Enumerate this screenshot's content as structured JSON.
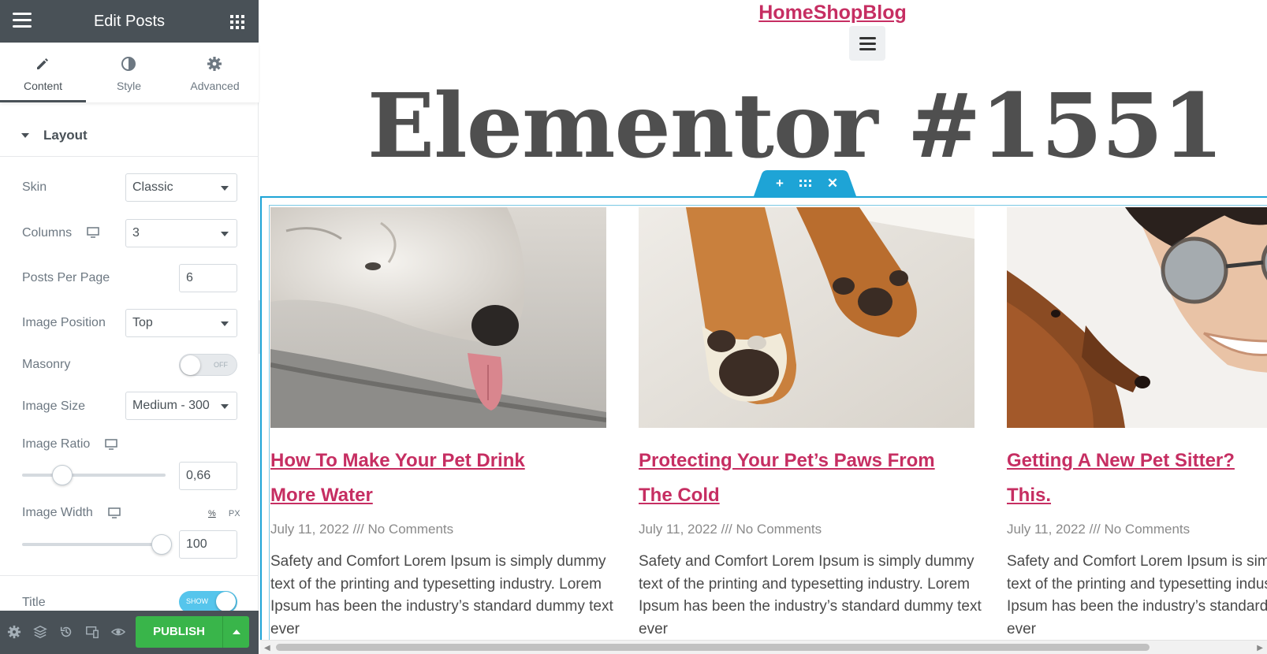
{
  "panel": {
    "title": "Edit Posts",
    "tabs": [
      {
        "label": "Content",
        "icon": "pencil-icon",
        "active": true
      },
      {
        "label": "Style",
        "icon": "half-circle-icon",
        "active": false
      },
      {
        "label": "Advanced",
        "icon": "gear-icon",
        "active": false
      }
    ],
    "section_label": "Layout",
    "controls": {
      "skin": {
        "label": "Skin",
        "value": "Classic"
      },
      "columns": {
        "label": "Columns",
        "value": "3"
      },
      "posts_per_page": {
        "label": "Posts Per Page",
        "value": "6"
      },
      "image_position": {
        "label": "Image Position",
        "value": "Top"
      },
      "masonry": {
        "label": "Masonry",
        "state": "OFF"
      },
      "image_size": {
        "label": "Image Size",
        "value": "Medium - 300"
      },
      "image_ratio": {
        "label": "Image Ratio",
        "value": "0,66"
      },
      "image_width": {
        "label": "Image Width",
        "value": "100",
        "unit_percent": "%",
        "unit_px": "PX"
      },
      "title": {
        "label": "Title",
        "state": "SHOW"
      }
    },
    "footer": {
      "publish_label": "PUBLISH"
    },
    "colors": {
      "header": "#495157",
      "publish": "#39b54a",
      "accent": "#c62e62",
      "selection": "#1ea4d6"
    }
  },
  "preview": {
    "site_title": "HomeShopBlog",
    "page_title": "Elementor #1551",
    "posts": [
      {
        "title_line1": "How To Make Your Pet Drink",
        "title_line2": "More Water",
        "meta": "July 11, 2022 /// No Comments",
        "excerpt": "Safety and Comfort Lorem Ipsum is simply dummy text of the printing and typesetting industry. Lorem Ipsum has been the industry’s standard dummy text ever"
      },
      {
        "title_line1": "Protecting Your Pet’s Paws From",
        "title_line2": "The Cold",
        "meta": "July 11, 2022 /// No Comments",
        "excerpt": "Safety and Comfort Lorem Ipsum is simply dummy text of the printing and typesetting industry. Lorem Ipsum has been the industry’s standard dummy text ever"
      },
      {
        "title_line1": "Getting A New Pet Sitter? ",
        "title_line2": "This.",
        "meta": "July 11, 2022 /// No Comments",
        "excerpt": "Safety and Comfort Lorem Ipsum is simply dummy text of the printing and typesetting industry. Lorem Ipsum has been the industry’s standard dummy text ever"
      }
    ]
  }
}
